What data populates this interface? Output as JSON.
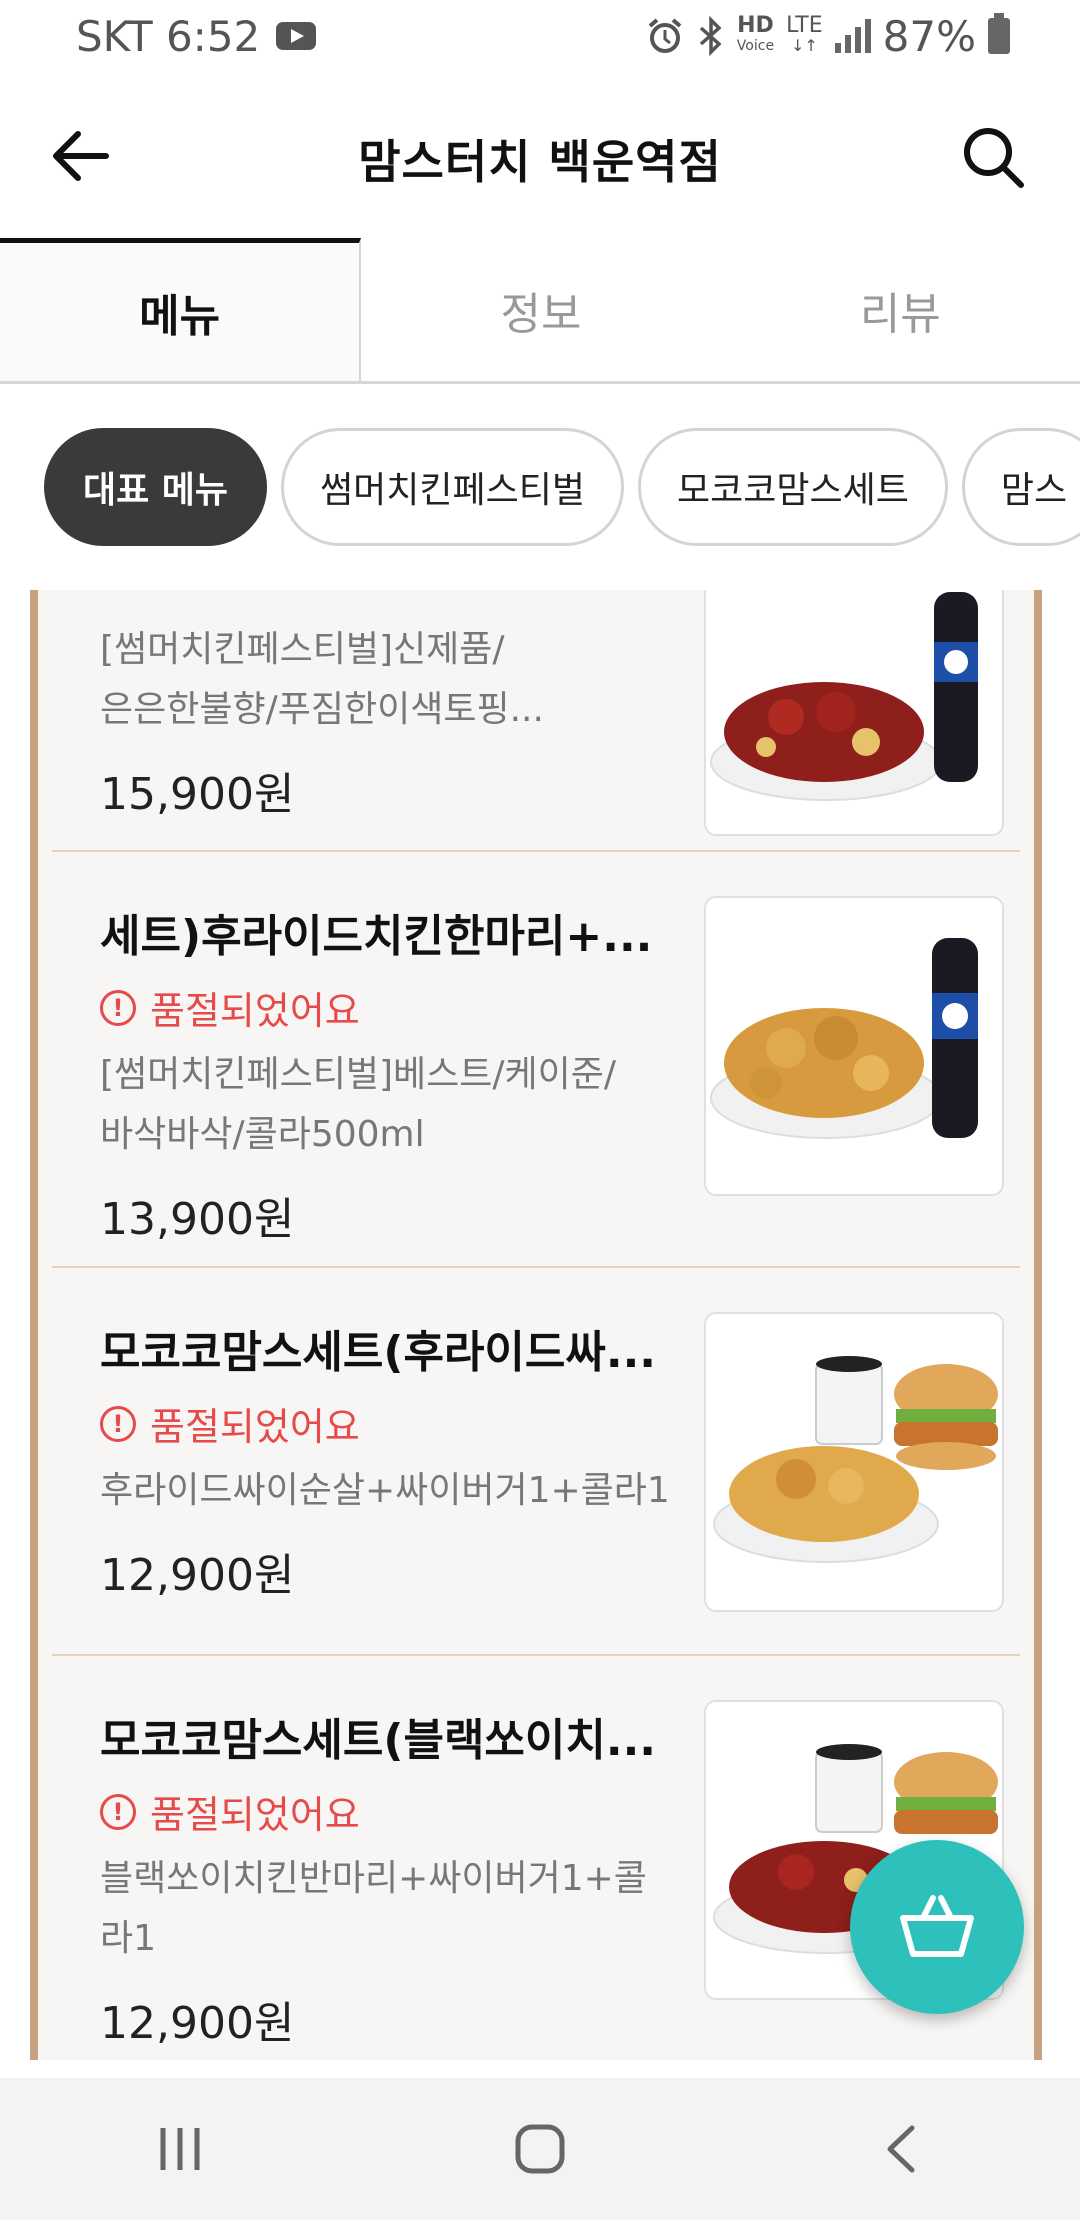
{
  "status_bar": {
    "carrier_time": "SKT 6:52",
    "hd_label": "HD",
    "voice_label": "Voice",
    "lte_label": "LTE",
    "battery": "87%"
  },
  "header": {
    "title": "맘스터치 백운역점",
    "back_icon": "back-arrow-icon",
    "search_icon": "search-icon"
  },
  "tabs": [
    {
      "label": "메뉴",
      "active": true
    },
    {
      "label": "정보",
      "active": false
    },
    {
      "label": "리뷰",
      "active": false
    }
  ],
  "chips": [
    {
      "label": "대표 메뉴",
      "active": true
    },
    {
      "label": "썸머치킨페스티벌",
      "active": false
    },
    {
      "label": "모코코맘스세트",
      "active": false
    },
    {
      "label": "맘스",
      "active": false
    }
  ],
  "menu_items": [
    {
      "name": "",
      "soldout": "",
      "desc_line1": "[썸머치킨페스티벌]신제품/",
      "desc_line2": "은은한불향/푸짐한이색토핑...",
      "price": "15,900원",
      "image": "spicy-chicken-cola"
    },
    {
      "name": "세트)후라이드치킨한마리+...",
      "soldout": "품절되었어요",
      "desc_line1": "[썸머치킨페스티벌]베스트/케이준/",
      "desc_line2": "바삭바삭/콜라500ml",
      "price": "13,900원",
      "image": "fried-chicken-cola"
    },
    {
      "name": "모코코맘스세트(후라이드싸...",
      "soldout": "품절되었어요",
      "desc_line1": "후라이드싸이순살+싸이버거1+콜라1",
      "desc_line2": "",
      "price": "12,900원",
      "image": "fried-chicken-burger"
    },
    {
      "name": "모코코맘스세트(블랙쏘이치...",
      "soldout": "품절되었어요",
      "desc_line1": "블랙쏘이치킨반마리+싸이버거1+콜",
      "desc_line2": "라1",
      "price": "12,900원",
      "image": "black-soy-chicken-burger"
    }
  ],
  "cart_icon": "shopping-basket-icon",
  "nav": {
    "recent_icon": "recent-apps-icon",
    "home_icon": "home-icon",
    "back_icon": "nav-back-icon"
  },
  "colors": {
    "accent_teal": "#2ec0bb",
    "soldout_red": "#e54b4b",
    "frame_brown": "#c5a27d"
  }
}
